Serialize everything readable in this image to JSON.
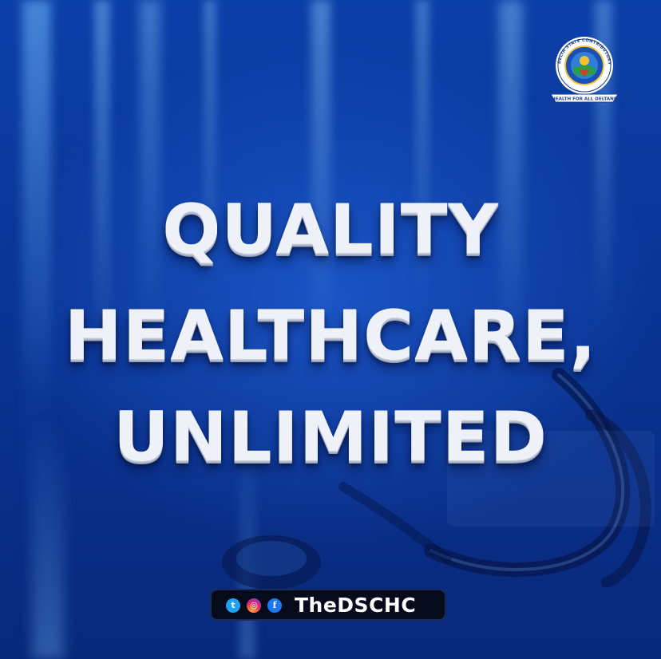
{
  "headline": {
    "line1": "QUALITY",
    "line2": "HEALTHCARE,",
    "line3": "UNLIMITED"
  },
  "logo": {
    "arc_text": "DELTA STATE CONTRIBUTORY HEALTH COMMISSION",
    "motto": "HEALTH FOR ALL DELTANS",
    "icon": "commission-seal-icon"
  },
  "social": {
    "icons": [
      "twitter-icon",
      "instagram-icon",
      "facebook-icon"
    ],
    "twitter_glyph": "t",
    "instagram_glyph": "◎",
    "facebook_glyph": "f",
    "handle": "TheDSCHC"
  },
  "colors": {
    "background": "#0a3595",
    "headline": "#eef1f7",
    "social_bar": "#060b1c",
    "twitter": "#1da1f2",
    "facebook": "#1877f2"
  }
}
